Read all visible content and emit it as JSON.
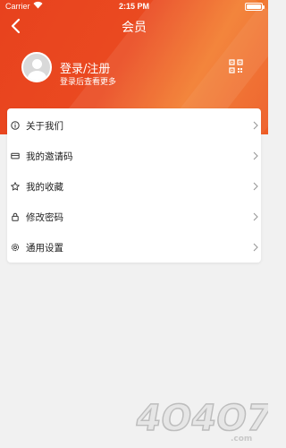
{
  "status_bar": {
    "carrier": "Carrier",
    "time": "2:15 PM"
  },
  "header": {
    "title": "会员",
    "login_title": "登录/注册",
    "login_subtitle": "登录后查看更多"
  },
  "menu": {
    "items": [
      {
        "label": "关于我们",
        "icon": "info-icon"
      },
      {
        "label": "我的邀请码",
        "icon": "ticket-icon"
      },
      {
        "label": "我的收藏",
        "icon": "star-icon"
      },
      {
        "label": "修改密码",
        "icon": "lock-icon"
      },
      {
        "label": "通用设置",
        "icon": "gear-icon"
      }
    ]
  },
  "watermark": {
    "text": "4O4O7.com"
  },
  "colors": {
    "header_primary": "#e8421e",
    "header_accent": "#f27b2c",
    "background": "#f1f1f1",
    "card": "#ffffff"
  }
}
